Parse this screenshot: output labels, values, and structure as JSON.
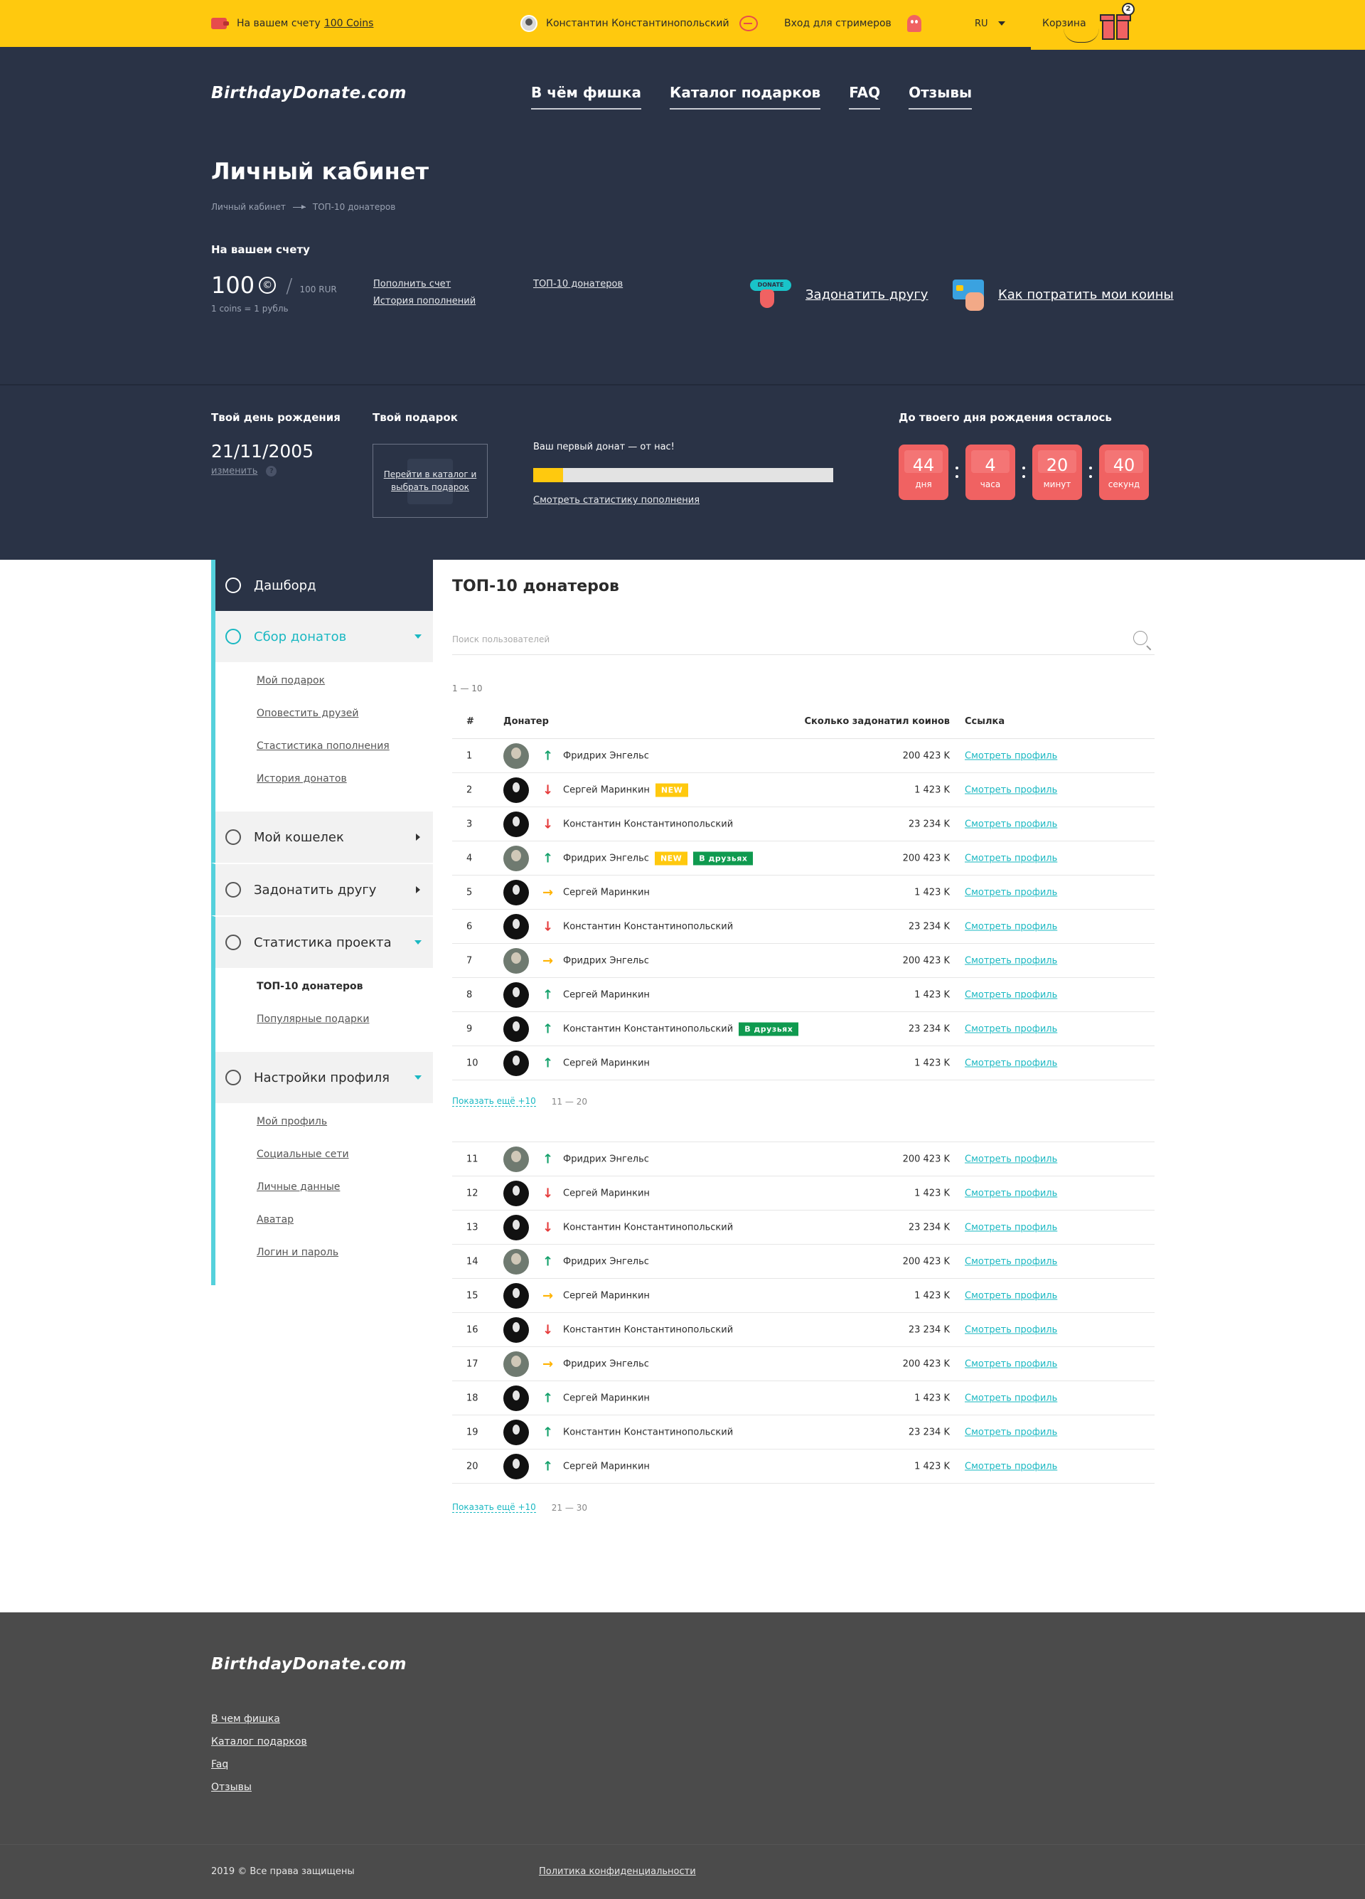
{
  "topbar": {
    "balance_prefix": "На вашем счету",
    "balance_link": "100 Coins",
    "user_name": "Константин Константинопольский",
    "streamers": "Вход для стримеров",
    "lang": "RU",
    "cart": "Корзина",
    "cart_count": "2"
  },
  "header": {
    "logo": "BirthdayDonate.com",
    "nav": [
      "В чём фишка",
      "Каталог подарков",
      "FAQ",
      "Отзывы"
    ],
    "title": "Личный кабинет",
    "breadcrumbs": [
      "Личный кабинет",
      "ТОП-10 донатеров"
    ]
  },
  "balance": {
    "label": "На вашем счету",
    "amount": "100",
    "coin_symbol": "©",
    "rur": "100 RUR",
    "rate": "1 coins = 1 рубль",
    "topup": "Пополнить счет",
    "history": "История пополнений",
    "top10": "ТОП-10 донатеров",
    "donate_friend": "Задонатить другу",
    "donate_badge": "DONATE",
    "spend": "Как потратить мои коины"
  },
  "birthday": {
    "label": "Твой день рождения",
    "date": "21/11/2005",
    "change": "изменить",
    "help": "?",
    "gift_label": "Твой подарок",
    "gift_cta": "Перейти в каталог и выбрать подарок",
    "first_donate": "Ваш первый донат — от нас!",
    "progress": 0.1,
    "stats_link": "Смотреть статистику пополнения",
    "countdown_label": "До твоего дня рождения осталось",
    "countdown": [
      {
        "value": "44",
        "unit": "дня"
      },
      {
        "value": "4",
        "unit": "часа"
      },
      {
        "value": "20",
        "unit": "минут"
      },
      {
        "value": "40",
        "unit": "секунд"
      }
    ]
  },
  "sidebar": {
    "dashboard": "Дашборд",
    "collect": "Сбор донатов",
    "collect_items": [
      "Мой подарок",
      "Оповестить друзей",
      "Стастистика пополнения",
      "История донатов"
    ],
    "wallet": "Мой кошелек",
    "donate": "Задонатить другу",
    "stats": "Статистика проекта",
    "stats_items": [
      "ТОП-10 донатеров",
      "Популярные подарки"
    ],
    "settings": "Настройки профиля",
    "settings_items": [
      "Мой профиль",
      "Социальные сети",
      "Личные данные",
      "Аватар",
      "Логин и пароль"
    ]
  },
  "main": {
    "title": "ТОП-10 донатеров",
    "search_placeholder": "Поиск пользователей",
    "range1": "1 — 10",
    "columns": [
      "#",
      "Донатер",
      "Сколько задонатил коинов",
      "Ссылка"
    ],
    "show_more": "Показать ещё +10",
    "next_range1": "11 — 20",
    "next_range2": "21 — 30",
    "rows": [
      {
        "n": "1",
        "name": "Фридрих Энгельс",
        "dir": "up",
        "amount": "200 423 K",
        "link": "Смотреть профиль",
        "tags": [],
        "avatar": "light"
      },
      {
        "n": "2",
        "name": "Сергей Маринкин",
        "dir": "down",
        "amount": "1 423 K",
        "link": "Смотреть профиль",
        "tags": [
          "NEW"
        ],
        "avatar": "dark"
      },
      {
        "n": "3",
        "name": "Константин Константинопольский",
        "dir": "down",
        "amount": "23 234 K",
        "link": "Смотреть профиль",
        "tags": [],
        "avatar": "dark"
      },
      {
        "n": "4",
        "name": "Фридрих Энгельс",
        "dir": "up",
        "amount": "200 423 K",
        "link": "Смотреть профиль",
        "tags": [
          "NEW",
          "В друзьях"
        ],
        "avatar": "light"
      },
      {
        "n": "5",
        "name": "Сергей Маринкин",
        "dir": "same",
        "amount": "1 423 K",
        "link": "Смотреть профиль",
        "tags": [],
        "avatar": "dark"
      },
      {
        "n": "6",
        "name": "Константин Константинопольский",
        "dir": "down",
        "amount": "23 234 K",
        "link": "Смотреть профиль",
        "tags": [],
        "avatar": "dark"
      },
      {
        "n": "7",
        "name": "Фридрих Энгельс",
        "dir": "same",
        "amount": "200 423 K",
        "link": "Смотреть профиль",
        "tags": [],
        "avatar": "light"
      },
      {
        "n": "8",
        "name": "Сергей Маринкин",
        "dir": "up",
        "amount": "1 423 K",
        "link": "Смотреть профиль",
        "tags": [],
        "avatar": "dark"
      },
      {
        "n": "9",
        "name": "Константин Константинопольский",
        "dir": "up",
        "amount": "23 234 K",
        "link": "Смотреть профиль",
        "tags": [
          "В друзьях"
        ],
        "avatar": "dark"
      },
      {
        "n": "10",
        "name": "Сергей Маринкин",
        "dir": "up",
        "amount": "1 423 K",
        "link": "Смотреть профиль",
        "tags": [],
        "avatar": "dark"
      }
    ],
    "rows2": [
      {
        "n": "11",
        "name": "Фридрих Энгельс",
        "dir": "up",
        "amount": "200 423 K",
        "link": "Смотреть профиль",
        "tags": [],
        "avatar": "light"
      },
      {
        "n": "12",
        "name": "Сергей Маринкин",
        "dir": "down",
        "amount": "1 423 K",
        "link": "Смотреть профиль",
        "tags": [],
        "avatar": "dark"
      },
      {
        "n": "13",
        "name": "Константин Константинопольский",
        "dir": "down",
        "amount": "23 234 K",
        "link": "Смотреть профиль",
        "tags": [],
        "avatar": "dark"
      },
      {
        "n": "14",
        "name": "Фридрих Энгельс",
        "dir": "up",
        "amount": "200 423 K",
        "link": "Смотреть профиль",
        "tags": [],
        "avatar": "light"
      },
      {
        "n": "15",
        "name": "Сергей Маринкин",
        "dir": "same",
        "amount": "1 423 K",
        "link": "Смотреть профиль",
        "tags": [],
        "avatar": "dark"
      },
      {
        "n": "16",
        "name": "Константин Константинопольский",
        "dir": "down",
        "amount": "23 234 K",
        "link": "Смотреть профиль",
        "tags": [],
        "avatar": "dark"
      },
      {
        "n": "17",
        "name": "Фридрих Энгельс",
        "dir": "same",
        "amount": "200 423 K",
        "link": "Смотреть профиль",
        "tags": [],
        "avatar": "light"
      },
      {
        "n": "18",
        "name": "Сергей Маринкин",
        "dir": "up",
        "amount": "1 423 K",
        "link": "Смотреть профиль",
        "tags": [],
        "avatar": "dark"
      },
      {
        "n": "19",
        "name": "Константин Константинопольский",
        "dir": "up",
        "amount": "23 234 K",
        "link": "Смотреть профиль",
        "tags": [],
        "avatar": "dark"
      },
      {
        "n": "20",
        "name": "Сергей Маринкин",
        "dir": "up",
        "amount": "1 423 K",
        "link": "Смотреть профиль",
        "tags": [],
        "avatar": "dark"
      }
    ]
  },
  "footer": {
    "logo": "BirthdayDonate.com",
    "links": [
      "В чем фишка",
      "Каталог подарков",
      "Faq",
      "Отзывы"
    ],
    "copyright": "2019 © Все права защищены",
    "privacy": "Политика конфиденциальности"
  },
  "colors": {
    "accent": "#ffc90e",
    "dark": "#2a3346",
    "teal": "#1ab8c2",
    "red": "#f06262",
    "green": "#0f9a4f"
  }
}
